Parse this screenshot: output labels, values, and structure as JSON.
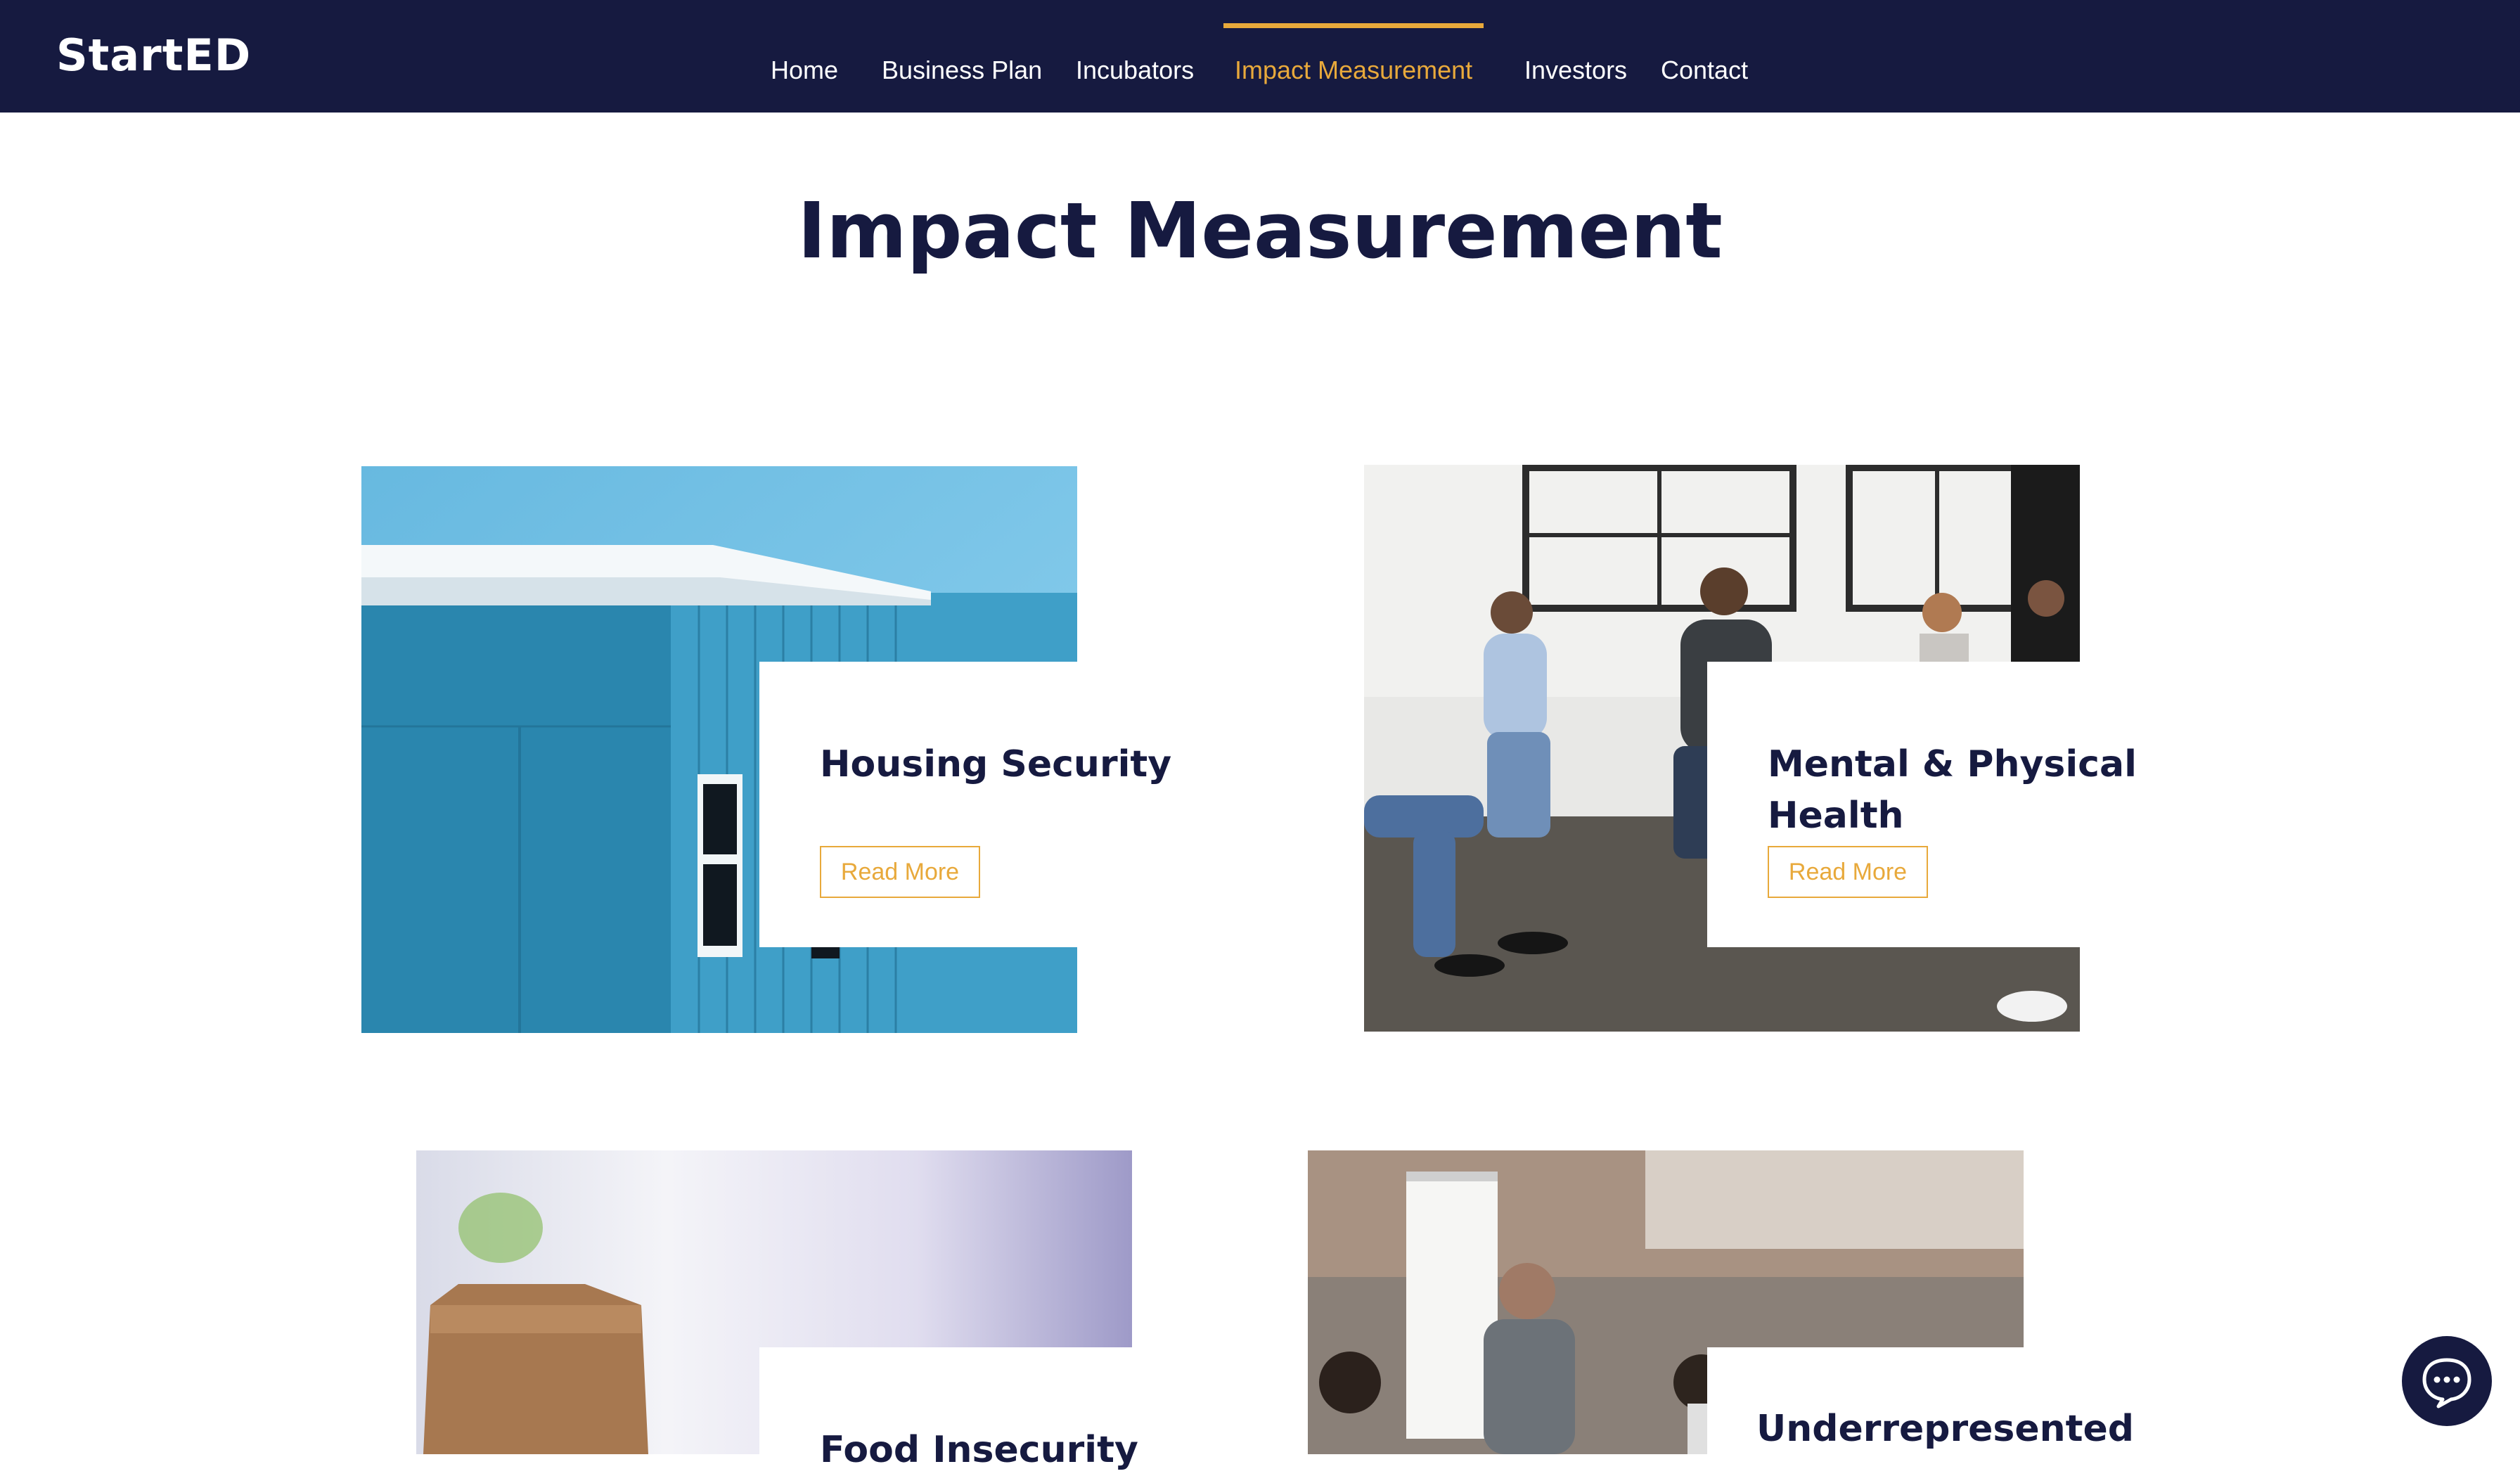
{
  "site": {
    "logo": "StartED"
  },
  "nav": [
    {
      "label": "Home"
    },
    {
      "label": "Business Plan"
    },
    {
      "label": "Incubators"
    },
    {
      "label": "Impact Measurement",
      "active": true
    },
    {
      "label": "Investors"
    },
    {
      "label": "Contact"
    }
  ],
  "page": {
    "title": "Impact Measurement"
  },
  "cards": [
    {
      "title": "Housing Security",
      "button": "Read More",
      "image": "blue-house-photo"
    },
    {
      "title_line1": "Mental & Physical",
      "title_line2": "Health",
      "button": "Read More",
      "image": "support-group-photo"
    },
    {
      "title": "Food Insecurity",
      "image": "paper-bag-photo"
    },
    {
      "title": "Underrepresented",
      "image": "office-meeting-photo"
    }
  ],
  "chat": {
    "icon": "chat-bubble-icon"
  },
  "colors": {
    "navy": "#161a40",
    "accent": "#e8a93b",
    "white": "#ffffff"
  }
}
